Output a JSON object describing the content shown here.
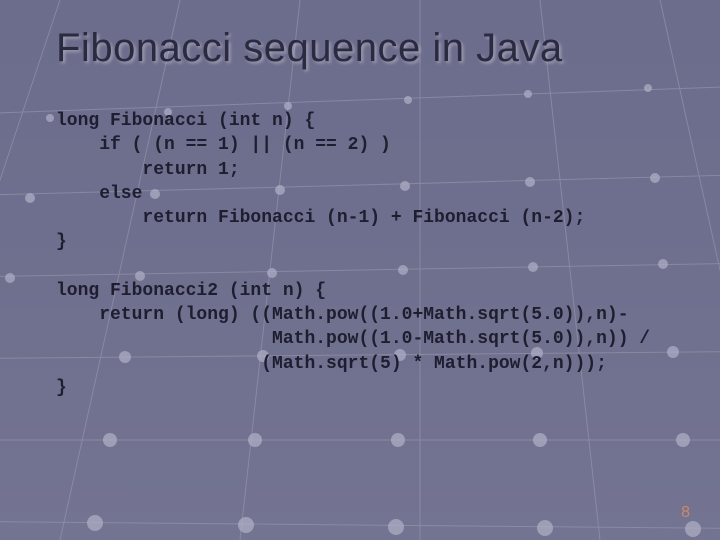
{
  "slide": {
    "title": "Fibonacci sequence in Java",
    "code1": "long Fibonacci (int n) {\n    if ( (n == 1) || (n == 2) )\n        return 1;\n    else\n        return Fibonacci (n-1) + Fibonacci (n-2);\n}",
    "code2": "long Fibonacci2 (int n) {\n    return (long) ((Math.pow((1.0+Math.sqrt(5.0)),n)-\n                    Math.pow((1.0-Math.sqrt(5.0)),n)) /\n                   (Math.sqrt(5) * Math.pow(2,n)));\n}",
    "page_number": "8"
  }
}
